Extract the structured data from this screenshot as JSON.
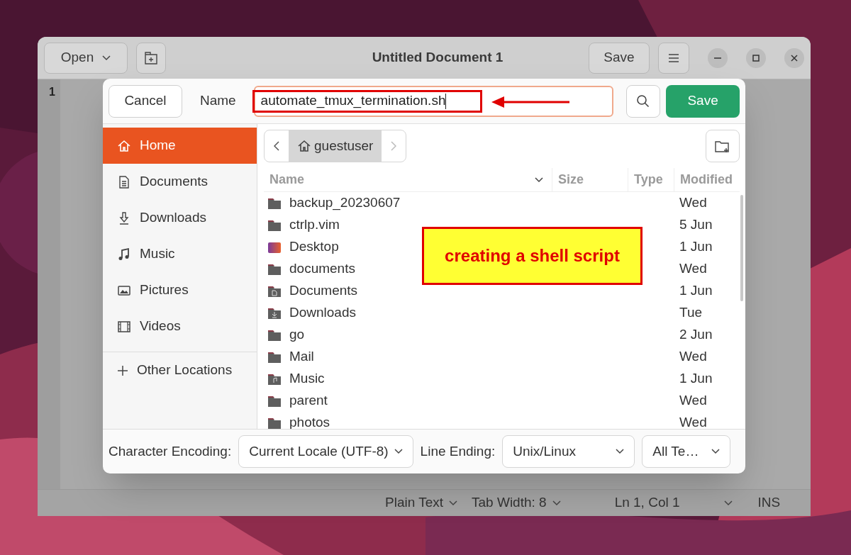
{
  "window": {
    "title": "Untitled Document 1",
    "open_button": "Open",
    "save_button": "Save",
    "line_number": "1"
  },
  "status_bar": {
    "language": "Plain Text",
    "tab_width": "Tab Width: 8",
    "position": "Ln 1, Col 1",
    "mode": "INS"
  },
  "dialog": {
    "cancel_button": "Cancel",
    "name_label": "Name",
    "name_value": "automate_tmux_termination.sh",
    "save_button": "Save",
    "sidebar": {
      "items": [
        {
          "label": "Home",
          "kind": "home",
          "selected": true
        },
        {
          "label": "Documents",
          "kind": "documents",
          "selected": false
        },
        {
          "label": "Downloads",
          "kind": "downloads",
          "selected": false
        },
        {
          "label": "Music",
          "kind": "music",
          "selected": false
        },
        {
          "label": "Pictures",
          "kind": "pictures",
          "selected": false
        },
        {
          "label": "Videos",
          "kind": "videos",
          "selected": false
        }
      ],
      "other": {
        "label": "Other Locations",
        "selected": false
      }
    },
    "path": {
      "crumb": "guestuser"
    },
    "table": {
      "columns": [
        "Name",
        "Size",
        "Type",
        "Modified"
      ],
      "rows": [
        {
          "name": "backup_20230607",
          "kind": "folder",
          "modified": "Wed"
        },
        {
          "name": "ctrlp.vim",
          "kind": "folder",
          "modified": "5 Jun"
        },
        {
          "name": "Desktop",
          "kind": "desktop",
          "modified": "1 Jun"
        },
        {
          "name": "documents",
          "kind": "folder",
          "modified": "Wed"
        },
        {
          "name": "Documents",
          "kind": "documents",
          "modified": "1 Jun"
        },
        {
          "name": "Downloads",
          "kind": "downloads",
          "modified": "Tue"
        },
        {
          "name": "go",
          "kind": "folder",
          "modified": "2 Jun"
        },
        {
          "name": "Mail",
          "kind": "folder",
          "modified": "Wed"
        },
        {
          "name": "Music",
          "kind": "music",
          "modified": "1 Jun"
        },
        {
          "name": "parent",
          "kind": "folder",
          "modified": "Wed"
        },
        {
          "name": "photos",
          "kind": "folder",
          "modified": "Wed"
        }
      ]
    },
    "bottom": {
      "encoding_label": "Character Encoding:",
      "encoding": "Current Locale (UTF-8)",
      "line_ending_label": "Line Ending:",
      "line_ending": "Unix/Linux",
      "filter": "All Te…"
    }
  },
  "annotation": {
    "callout": "creating a shell script"
  }
}
